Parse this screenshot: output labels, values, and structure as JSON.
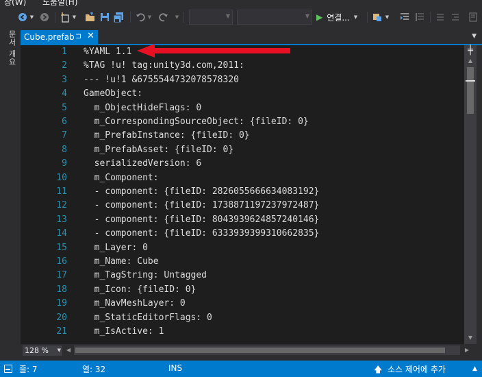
{
  "menu": {
    "items": [
      "창(W)",
      "도움말(H)"
    ]
  },
  "toolbar": {
    "run_label": "연결...",
    "icons": [
      "back-icon",
      "forward-icon",
      "new-project-icon",
      "open-folder-icon",
      "save-icon",
      "save-all-icon",
      "undo-icon",
      "redo-icon",
      "start-icon"
    ]
  },
  "left_panel": {
    "label": "문서 개요"
  },
  "tab": {
    "label": "Cube.prefab",
    "pin_glyph": "⊐",
    "close_glyph": "✕"
  },
  "editor": {
    "lines": [
      {
        "n": "1",
        "text": "%YAML 1.1"
      },
      {
        "n": "2",
        "text": "%TAG !u! tag:unity3d.com,2011:"
      },
      {
        "n": "3",
        "text": "--- !u!1 &6755544732078578320"
      },
      {
        "n": "4",
        "text": "GameObject:"
      },
      {
        "n": "5",
        "text": "  m_ObjectHideFlags: 0"
      },
      {
        "n": "6",
        "text": "  m_CorrespondingSourceObject: {fileID: 0}"
      },
      {
        "n": "7",
        "text": "  m_PrefabInstance: {fileID: 0}"
      },
      {
        "n": "8",
        "text": "  m_PrefabAsset: {fileID: 0}"
      },
      {
        "n": "9",
        "text": "  serializedVersion: 6"
      },
      {
        "n": "10",
        "text": "  m_Component:"
      },
      {
        "n": "11",
        "text": "  - component: {fileID: 2826055666634083192}"
      },
      {
        "n": "12",
        "text": "  - component: {fileID: 1738871197237972487}"
      },
      {
        "n": "13",
        "text": "  - component: {fileID: 8043939624857240146}"
      },
      {
        "n": "14",
        "text": "  - component: {fileID: 6333939399310662835}"
      },
      {
        "n": "15",
        "text": "  m_Layer: 0"
      },
      {
        "n": "16",
        "text": "  m_Name: Cube"
      },
      {
        "n": "17",
        "text": "  m_TagString: Untagged"
      },
      {
        "n": "18",
        "text": "  m_Icon: {fileID: 0}"
      },
      {
        "n": "19",
        "text": "  m_NavMeshLayer: 0"
      },
      {
        "n": "20",
        "text": "  m_StaticEditorFlags: 0"
      },
      {
        "n": "21",
        "text": "  m_IsActive: 1"
      }
    ]
  },
  "zoom": {
    "value": "128 %"
  },
  "status": {
    "line": "줄: 7",
    "column": "열: 32",
    "mode": "INS",
    "source_control": "소스 제어에 추가"
  },
  "colors": {
    "accent": "#007acc",
    "annotation_arrow": "#e81123",
    "line_number": "#2b91af",
    "editor_bg": "#1e1e1e"
  }
}
